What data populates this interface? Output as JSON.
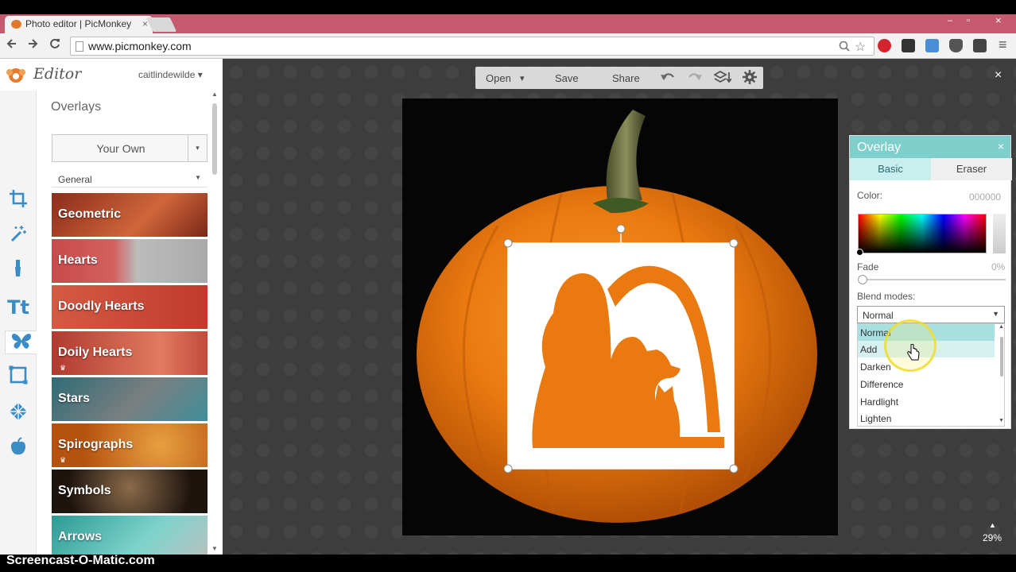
{
  "browser": {
    "tab_title": "Photo editor | PicMonkey",
    "tab_close": "×",
    "url": "www.picmonkey.com",
    "back_icon": "arrow-left",
    "forward_icon": "arrow-right",
    "reload_icon": "reload",
    "window_controls": [
      "–",
      "▫",
      "×"
    ]
  },
  "editor": {
    "logo_text": "Editor",
    "username": "caitlindewilde",
    "user_caret": "▾"
  },
  "overlays_panel": {
    "title": "Overlays",
    "your_own_label": "Your Own",
    "your_own_caret": "▾",
    "general_label": "General",
    "general_caret": "▼",
    "categories": [
      {
        "label": "Geometric",
        "color": "#b6402a"
      },
      {
        "label": "Hearts",
        "color": "#b9b9b9"
      },
      {
        "label": "Doodly Hearts",
        "color": "#d0523c"
      },
      {
        "label": "Doily Hearts",
        "color": "#c24a3b"
      },
      {
        "label": "Stars",
        "color": "#4b7d86"
      },
      {
        "label": "Spirographs",
        "color": "#c96a1d"
      },
      {
        "label": "Symbols",
        "color": "#3a2a1e"
      },
      {
        "label": "Arrows",
        "color": "#3fb0a8"
      }
    ],
    "premium_marker": "♛"
  },
  "toolbar": {
    "open_label": "Open",
    "open_caret": "▾",
    "save_label": "Save",
    "share_label": "Share",
    "close_label": "×"
  },
  "canvas": {
    "zoom_label": "29%",
    "zoom_arrow": "▲"
  },
  "overlay_settings": {
    "title": "Overlay",
    "close": "×",
    "tab_basic": "Basic",
    "tab_eraser": "Eraser",
    "color_label": "Color:",
    "color_value": "000000",
    "fade_label": "Fade",
    "fade_value": "0%",
    "blend_label": "Blend modes:",
    "blend_selected": "Normal",
    "blend_caret": "▼",
    "blend_options": [
      "Normal",
      "Add",
      "Darken",
      "Difference",
      "Hardlight",
      "Lighten"
    ],
    "list_up": "▲",
    "list_down": "▼"
  },
  "colors": {
    "accent_teal": "#7fcfcd",
    "pumpkin": "#e8760f",
    "tab_bar": "#c55a6e"
  },
  "watermark": "Screencast-O-Matic.com"
}
